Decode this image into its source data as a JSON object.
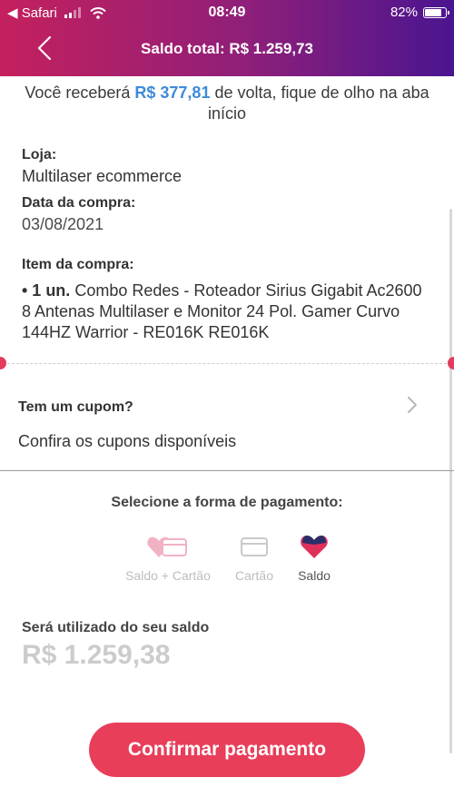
{
  "status_bar": {
    "carrier": "◀ Safari",
    "time": "08:49",
    "battery": "82%",
    "battery_level": 0.82
  },
  "header": {
    "title": "Saldo total: R$ 1.259,73"
  },
  "cashback": {
    "prefix": "Você receberá ",
    "amount": "R$ 377,81",
    "suffix": " de volta, fique de olho na aba início"
  },
  "store": {
    "label": "Loja:",
    "value": "Multilaser ecommerce"
  },
  "purchase_date": {
    "label": "Data da compra:",
    "value": "03/08/2021"
  },
  "purchase_item": {
    "label": "Item da compra:",
    "qty": "• 1 un.",
    "description": " Combo Redes - Roteador Sirius Gigabit Ac2600 8 Antenas Multilaser e Monitor 24 Pol. Gamer Curvo 144HZ Warrior - RE016K RE016K"
  },
  "coupon": {
    "title": "Tem um cupom?",
    "subtitle": "Confira os cupons disponíveis"
  },
  "payment": {
    "title": "Selecione a forma de pagamento:",
    "options": [
      {
        "label": "Saldo + Cartão",
        "icon": "balance-plus-card-icon"
      },
      {
        "label": "Cartão",
        "icon": "credit-card-icon"
      },
      {
        "label": "Saldo",
        "icon": "heart-balance-icon"
      }
    ],
    "selected": "Saldo"
  },
  "balance_used": {
    "label": "Será utilizado do seu saldo",
    "value": "R$ 1.259,38"
  },
  "confirm_button": "Confirmar pagamento",
  "colors": {
    "header_gradient": [
      "#c4205d",
      "#8e1f7a",
      "#4a1590"
    ],
    "accent_blue": "#3d8bd9",
    "button_red": "#e83e5a",
    "notch": "#e23b5c",
    "heart_top": "#2a2f6a",
    "heart_bottom": "#e0305a"
  }
}
